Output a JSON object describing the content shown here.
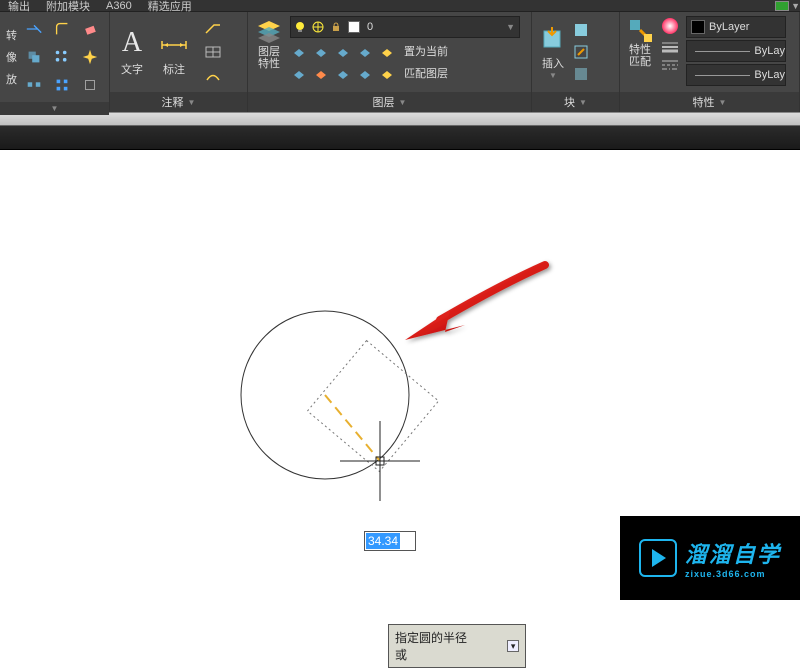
{
  "tabs": {
    "t1": "输出",
    "t2": "附加模块",
    "t3": "A360",
    "t4": "精选应用"
  },
  "modify": {
    "label1": "转",
    "label2": "像",
    "label3": "放"
  },
  "annotate": {
    "text": "文字",
    "dim": "标注",
    "title": "注释"
  },
  "layers": {
    "props": "图层\n特性",
    "current": "0",
    "set_current": "置为当前",
    "match": "匹配图层",
    "title": "图层"
  },
  "blocks": {
    "insert": "插入",
    "title": "块"
  },
  "properties": {
    "label": "特性\n匹配",
    "bylayer": "ByLayer",
    "bylayer2": "ByLay",
    "bylayer3": "ByLay",
    "title": "特性"
  },
  "canvas": {
    "radius_value": "34.34",
    "prompt": "指定圆的半径或"
  },
  "watermark": {
    "name": "溜溜自学",
    "url": "zixue.3d66.com"
  }
}
